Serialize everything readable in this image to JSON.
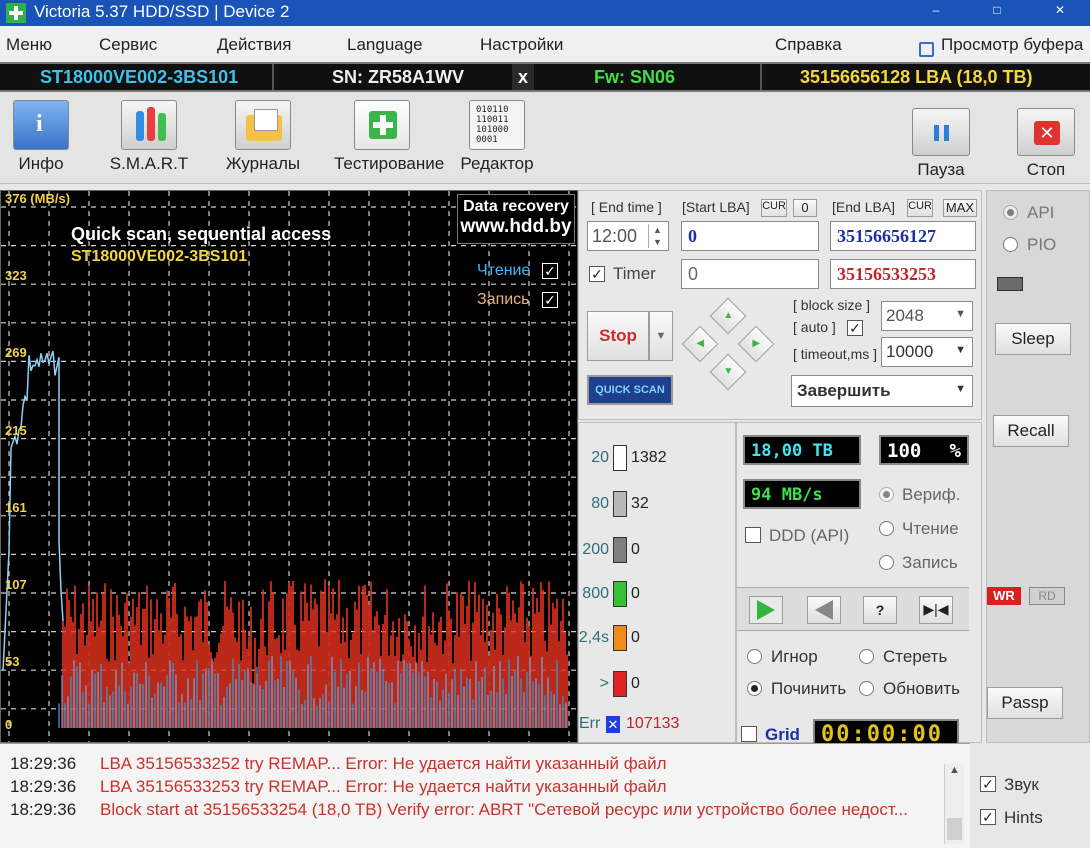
{
  "window": {
    "title": "Victoria 5.37 HDD/SSD | Device 2",
    "controls": [
      "–",
      "□",
      "✕"
    ]
  },
  "menu": {
    "items": [
      "Меню",
      "Сервис",
      "Действия",
      "Language",
      "Настройки",
      "Справка"
    ],
    "buffer": "Просмотр буфера"
  },
  "device": {
    "model": "ST18000VE002-3BS101",
    "serial": "SN: ZR58A1WV",
    "close": "x",
    "firmware": "Fw: SN06",
    "capacity": "35156656128 LBA (18,0 TB)"
  },
  "toolbar": {
    "info": "Инфо",
    "smart": "S.M.A.R.T",
    "logs": "Журналы",
    "testing": "Тестирование",
    "editor": "Редактор",
    "editor_icon_text": "010110\n110011\n101000\n0001",
    "pause": "Пауза",
    "stop": "Стоп"
  },
  "graph": {
    "y_ticks": [
      "376 (MB/s)",
      "323",
      "269",
      "215",
      "161",
      "107",
      "53",
      "0"
    ],
    "caption": "Quick scan, sequential access",
    "device_caption": "ST18000VE002-3BS101",
    "promo_line1": "Data recovery",
    "promo_line2": "www.hdd.by",
    "read_label": "Чтение",
    "write_label": "Запись",
    "colors": {
      "read_series": "#4fa3e0",
      "write_series": "#e8321e",
      "grid": "#cfcfcf"
    }
  },
  "controls": {
    "end_time_label": "[ End time ]",
    "end_time_value": "12:00",
    "timer_label": "Timer",
    "timer_value": "0",
    "start_lba_label": "[Start LBA]",
    "cur": "CUR",
    "zero": "0",
    "start_lba": "0",
    "end_lba_label": "[End LBA]",
    "max": "MAX",
    "end_lba": "35156656127",
    "current_lba": "35156533253",
    "stop_button": "Stop",
    "quick_scan": "QUICK SCAN",
    "block_size_label": "[ block size ]",
    "auto_label": "[ auto ]",
    "block_size": "2048",
    "timeout_label": "[ timeout,ms ]",
    "timeout": "10000",
    "finish": "Завершить"
  },
  "counters": [
    {
      "label": "20",
      "value": "1382",
      "color": "#ffffff"
    },
    {
      "label": "80",
      "value": "32",
      "color": "#b8b8b8"
    },
    {
      "label": "200",
      "value": "0",
      "color": "#7f7f7f"
    },
    {
      "label": "800",
      "value": "0",
      "color": "#33c233"
    },
    {
      "label": "2,4s",
      "value": "0",
      "color": "#f08a1c"
    },
    {
      "label": ">",
      "value": "0",
      "color": "#e02222"
    }
  ],
  "errors": {
    "label": "Err",
    "value": "107133"
  },
  "status": {
    "size": "18,00 TB",
    "percent": "100",
    "percent_sign": "%",
    "speed": "94 MB/s",
    "verify": "Вериф.",
    "read": "Чтение",
    "write": "Запись",
    "ddd": "DDD (API)",
    "ignore": "Игнор",
    "erase": "Стереть",
    "repair": "Починить",
    "refresh": "Обновить",
    "grid": "Grid",
    "clock": "00:00:00",
    "btn_verify_unknown": "?"
  },
  "right": {
    "api": "API",
    "pio": "PIO",
    "sleep": "Sleep",
    "recall": "Recall",
    "wr": "WR",
    "rd": "RD",
    "passp": "Passp",
    "sound": "Звук",
    "hints": "Hints"
  },
  "log": [
    {
      "time": "18:29:36",
      "message": "LBA 35156533252 try REMAP... Error: Не удается найти указанный файл"
    },
    {
      "time": "18:29:36",
      "message": "LBA 35156533253 try REMAP... Error: Не удается найти указанный файл"
    },
    {
      "time": "18:29:36",
      "message": "Block start at 35156533254 (18,0 TB) Verify error: ABRT \"Сетевой ресурс или устройство более недост..."
    }
  ]
}
